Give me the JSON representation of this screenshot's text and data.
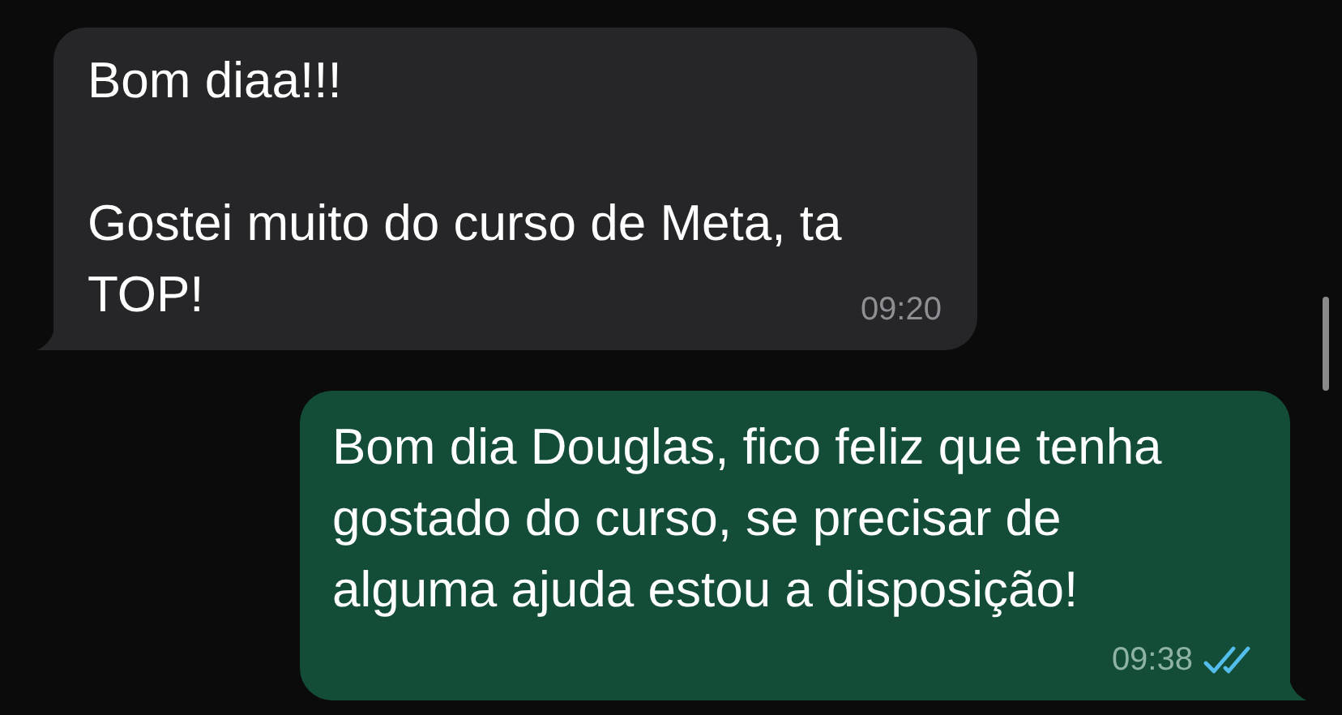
{
  "messages": [
    {
      "kind": "incoming",
      "paragraphs": [
        "Bom diaa!!!",
        "Gostei muito do curso de Meta, ta TOP!"
      ],
      "time": "09:20"
    },
    {
      "kind": "outgoing",
      "paragraphs": [
        "Bom dia Douglas, fico feliz que tenha gostado do curso, se precisar de alguma ajuda estou a disposição!"
      ],
      "time": "09:38",
      "read": true
    }
  ]
}
